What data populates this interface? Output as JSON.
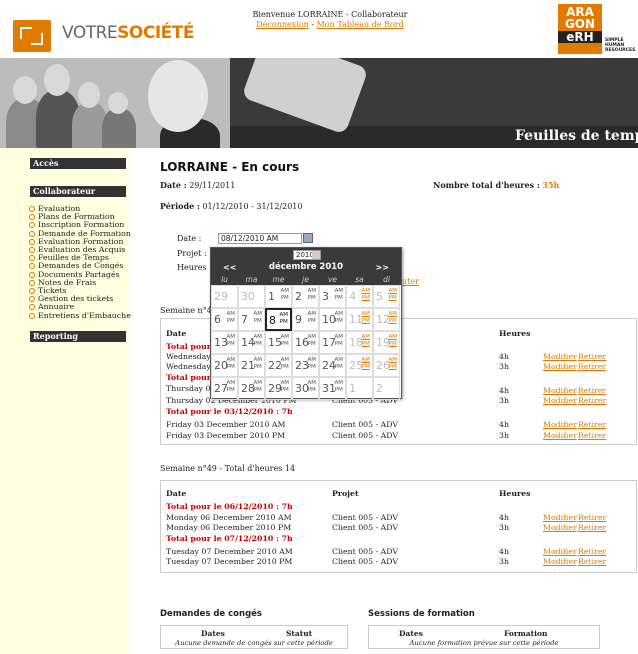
{
  "header": {
    "brand_plain": "VOTRE",
    "brand_accent": "SOCIÉTÉ",
    "welcome": "Bienvenue LORRAINE - Collaborateur",
    "logout": "Déconnexion",
    "separator": " - ",
    "dashboard": "Mon Tableau de Bord",
    "aragon_lines": [
      "ARA",
      "GON",
      "eRH"
    ],
    "aragon_tag": "SIMPLE HUMAN RESOURCES"
  },
  "banner": {
    "title": "Feuilles de temp"
  },
  "sidebar": {
    "sections": [
      "Accès",
      "Collaborateur",
      "Reporting"
    ],
    "items": [
      "Evaluation",
      "Plans de Formation",
      "Inscription Formation",
      "Demande de Formation",
      "Evaluation Formation",
      "Evaluation des Acquis",
      "Feuilles de Temps",
      "Demandes de Congés",
      "Documents Partagés",
      "Notes de Frais",
      "Tickets",
      "Gestion des tickets",
      "Annuaire",
      "Entretiens d'Embauche"
    ]
  },
  "page": {
    "title": "LORRAINE - En cours",
    "date_label": "Date :",
    "date_value": "29/11/2011",
    "total_label": "Nombre total d'heures :",
    "total_value": "35h",
    "periode_label": "Période :",
    "periode_value": "01/12/2010 - 31/12/2010"
  },
  "form": {
    "date_label": "Date :",
    "date_value": "08/12/2010 AM",
    "projet_label": "Projet :",
    "heures_label": "Heures :",
    "ajouter": "uter"
  },
  "calendar": {
    "year": "2010",
    "prev": "<<",
    "next": ">>",
    "month": "décembre 2010",
    "dow": [
      "lu",
      "ma",
      "me",
      "je",
      "ve",
      "sa",
      "di"
    ],
    "am": "AM",
    "pm": "PM",
    "weeks": [
      [
        "29",
        "30",
        "1",
        "2",
        "3",
        "4",
        "5"
      ],
      [
        "6",
        "7",
        "8",
        "9",
        "10",
        "11",
        "12"
      ],
      [
        "13",
        "14",
        "15",
        "16",
        "17",
        "18",
        "19"
      ],
      [
        "20",
        "21",
        "22",
        "23",
        "24",
        "25",
        "26"
      ],
      [
        "27",
        "28",
        "29",
        "30",
        "31",
        "1",
        "2"
      ]
    ]
  },
  "week48": {
    "label": "Semaine n°4",
    "headers": {
      "date": "Date",
      "heures": "Heures"
    },
    "rows": [
      {
        "kind": "total",
        "text": "Total pour"
      },
      {
        "kind": "entry",
        "date": "Wednesday",
        "heures": "4h",
        "mod": "Modifier",
        "ret": "Retirer"
      },
      {
        "kind": "entry",
        "date": "Wednesday",
        "heures": "3h",
        "mod": "Modifier",
        "ret": "Retirer"
      },
      {
        "kind": "total",
        "text": "Total pour"
      },
      {
        "kind": "entry",
        "date": "Thursday 0",
        "heures": "4h",
        "mod": "Modifier",
        "ret": "Retirer"
      },
      {
        "kind": "entry",
        "date": "Thursday 02 December 2010 PM",
        "projet": "Client 005 - ADV",
        "heures": "3h",
        "mod": "Modifier",
        "ret": "Retirer"
      },
      {
        "kind": "total",
        "text": "Total pour le 03/12/2010 : 7h"
      },
      {
        "kind": "entry",
        "date": "Friday 03 December 2010 AM",
        "projet": "Client 005 - ADV",
        "heures": "4h",
        "mod": "Modifier",
        "ret": "Retirer"
      },
      {
        "kind": "entry",
        "date": "Friday 03 December 2010 PM",
        "projet": "Client 005 - ADV",
        "heures": "3h",
        "mod": "Modifier",
        "ret": "Retirer"
      }
    ]
  },
  "week49": {
    "label": "Semaine n°49 - Total d'heures 14",
    "headers": {
      "date": "Date",
      "projet": "Projet",
      "heures": "Heures"
    },
    "rows": [
      {
        "kind": "total",
        "text": "Total pour le 06/12/2010 : 7h"
      },
      {
        "kind": "entry",
        "date": "Monday 06 December 2010 AM",
        "projet": "Client 005 - ADV",
        "heures": "4h",
        "mod": "Modifier",
        "ret": "Retirer"
      },
      {
        "kind": "entry",
        "date": "Monday 06 December 2010 PM",
        "projet": "Client 005 - ADV",
        "heures": "3h",
        "mod": "Modifier",
        "ret": "Retirer"
      },
      {
        "kind": "total",
        "text": "Total pour le 07/12/2010 : 7h"
      },
      {
        "kind": "entry",
        "date": "Tuesday 07 December 2010 AM",
        "projet": "Client 005 - ADV",
        "heures": "4h",
        "mod": "Modifier",
        "ret": "Retirer"
      },
      {
        "kind": "entry",
        "date": "Tuesday 07 December 2010 PM",
        "projet": "Client 005 - ADV",
        "heures": "3h",
        "mod": "Modifier",
        "ret": "Retirer"
      }
    ]
  },
  "conges": {
    "title": "Demandes de congés",
    "col1": "Dates",
    "col2": "Statut",
    "empty": "Aucune demande de congés sur cette période"
  },
  "formation": {
    "title": "Sessions de formation",
    "col1": "Dates",
    "col2": "Formation",
    "empty": "Aucune formation prévue sur cette période"
  },
  "colors": {
    "accent": "#e07b00",
    "total_red": "#cc0000",
    "dark": "#333333"
  }
}
